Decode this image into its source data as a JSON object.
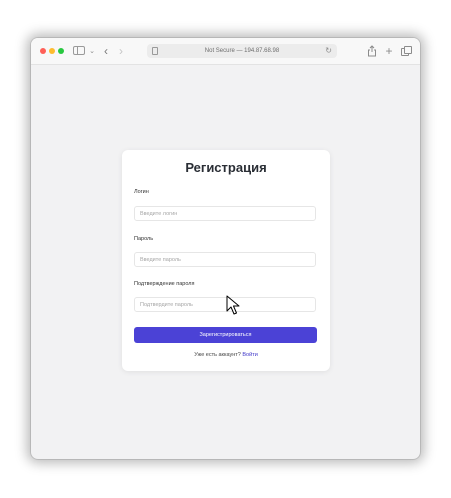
{
  "browser": {
    "address_text": "Not Secure — 194.87.68.98"
  },
  "form": {
    "title": "Регистрация",
    "login": {
      "label": "Логин",
      "placeholder": "Введите логин",
      "value": ""
    },
    "password": {
      "label": "Пароль",
      "placeholder": "Введите пароль",
      "value": ""
    },
    "confirm_password": {
      "label": "Подтверждение пароля",
      "placeholder": "Подтвердите пароль",
      "value": ""
    },
    "submit_label": "Зарегистрироваться",
    "have_account_text": "Уже есть аккаунт?",
    "login_link_text": "Войти"
  },
  "colors": {
    "accent": "#4b42d6",
    "link": "#3f36c9",
    "title": "#2a2e35",
    "page_background": "#f2f2f3"
  },
  "icons": [
    "sidebar-icon",
    "back-icon",
    "forward-icon",
    "page-icon",
    "reload-icon",
    "share-icon",
    "new-tab-icon",
    "tabs-overview-icon",
    "mouse-cursor-icon"
  ]
}
